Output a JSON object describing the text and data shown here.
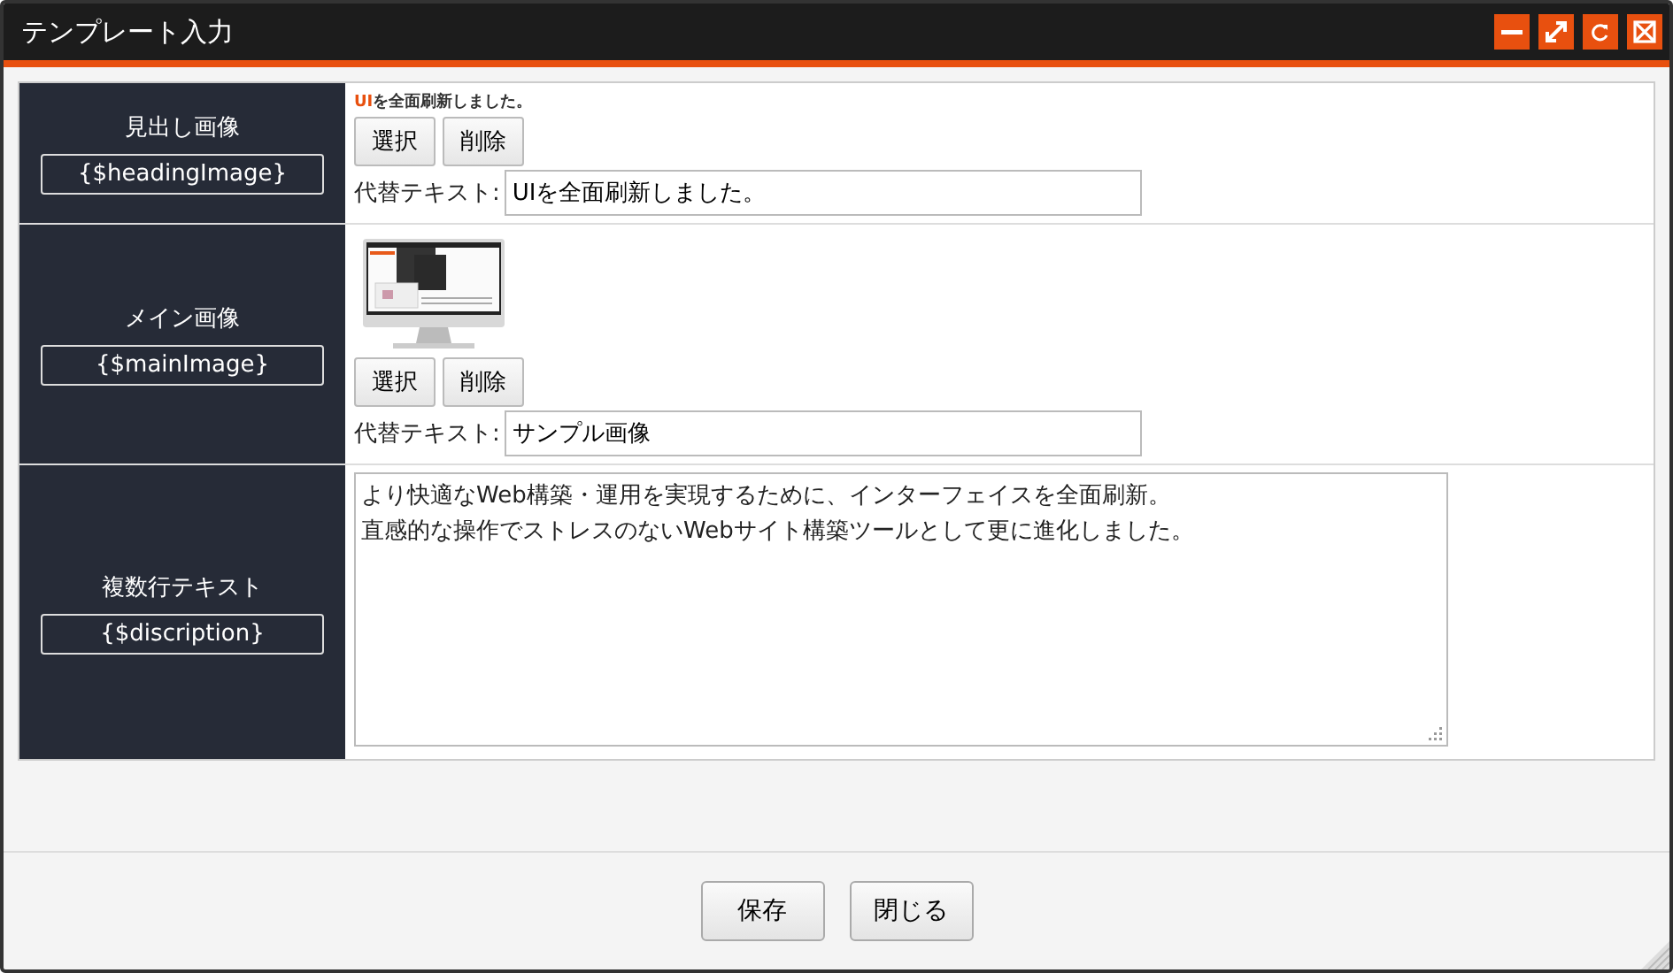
{
  "window": {
    "title": "テンプレート入力"
  },
  "title_buttons": [
    {
      "kind": "minimize"
    },
    {
      "kind": "maximize"
    },
    {
      "kind": "refresh"
    },
    {
      "kind": "close"
    }
  ],
  "rows": [
    {
      "kind": "image",
      "label": "見出し画像",
      "variable": "{$headingImage}",
      "preview": {
        "kind": "banner",
        "accent": "UI",
        "text": "を全面刷新しました。"
      },
      "buttons": [
        "選択",
        "削除"
      ],
      "alt_label": "代替テキスト:",
      "alt_value": "UIを全面刷新しました。"
    },
    {
      "kind": "image",
      "label": "メイン画像",
      "variable": "{$mainImage}",
      "preview": {
        "kind": "monitor"
      },
      "buttons": [
        "選択",
        "削除"
      ],
      "alt_label": "代替テキスト:",
      "alt_value": "サンプル画像"
    },
    {
      "kind": "textarea",
      "label": "複数行テキスト",
      "variable": "{$discription}",
      "lines": [
        "より快適なWeb構築・運用を実現するために、インターフェイスを全面刷新。",
        "直感的な操作でストレスのないWebサイト構築ツールとして更に進化しました。"
      ]
    }
  ],
  "footer_buttons": [
    "保存",
    "閉じる"
  ]
}
